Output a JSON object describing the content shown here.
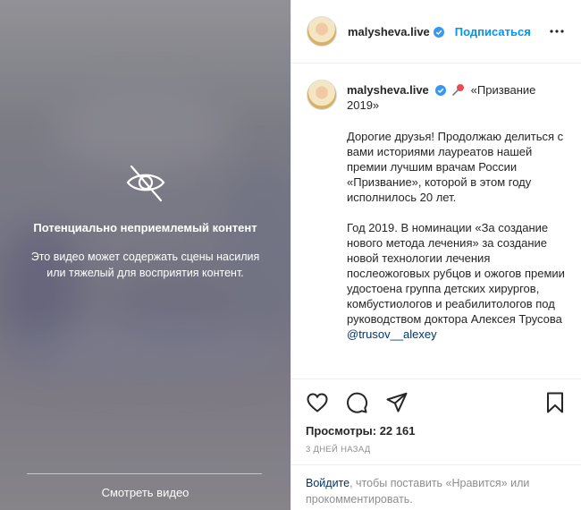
{
  "media": {
    "warning_title": "Потенциально неприемлемый контент",
    "warning_text": "Это видео может содержать сцены насилия или тяжелый для восприятия контент.",
    "watch_label": "Смотреть видео",
    "icon": "eye-slash-icon"
  },
  "header": {
    "username": "malysheva.live",
    "follow_label": "Подписаться",
    "more_icon": "more-horizontal-icon"
  },
  "caption": {
    "username": "malysheva.live",
    "title": "«Призвание 2019»",
    "paragraph1": "Дорогие друзья! Продолжаю делиться с вами историями лауреатов нашей премии лучшим врачам России «Призвание», которой в этом году исполнилось 20 лет.",
    "paragraph2": "Год 2019. В номинации «За создание нового метода лечения» за создание новой технологии лечения послеожоговых рубцов и ожогов премии удостоена группа детских хирургов, комбустиологов и реабилитологов под руководством доктора Алексея Трусова",
    "mention": "@trusov__alexey"
  },
  "stats": {
    "views": "Просмотры: 22 161",
    "time": "3 ДНЕЙ НАЗАД"
  },
  "login_prompt": {
    "link": "Войдите",
    "text": ", чтобы поставить «Нравится» или прокомментировать."
  },
  "colors": {
    "accent": "#0095f6",
    "link": "#00376b",
    "muted": "#8e8e8e",
    "verified": "#3897f0",
    "pin": "#ed4956"
  }
}
